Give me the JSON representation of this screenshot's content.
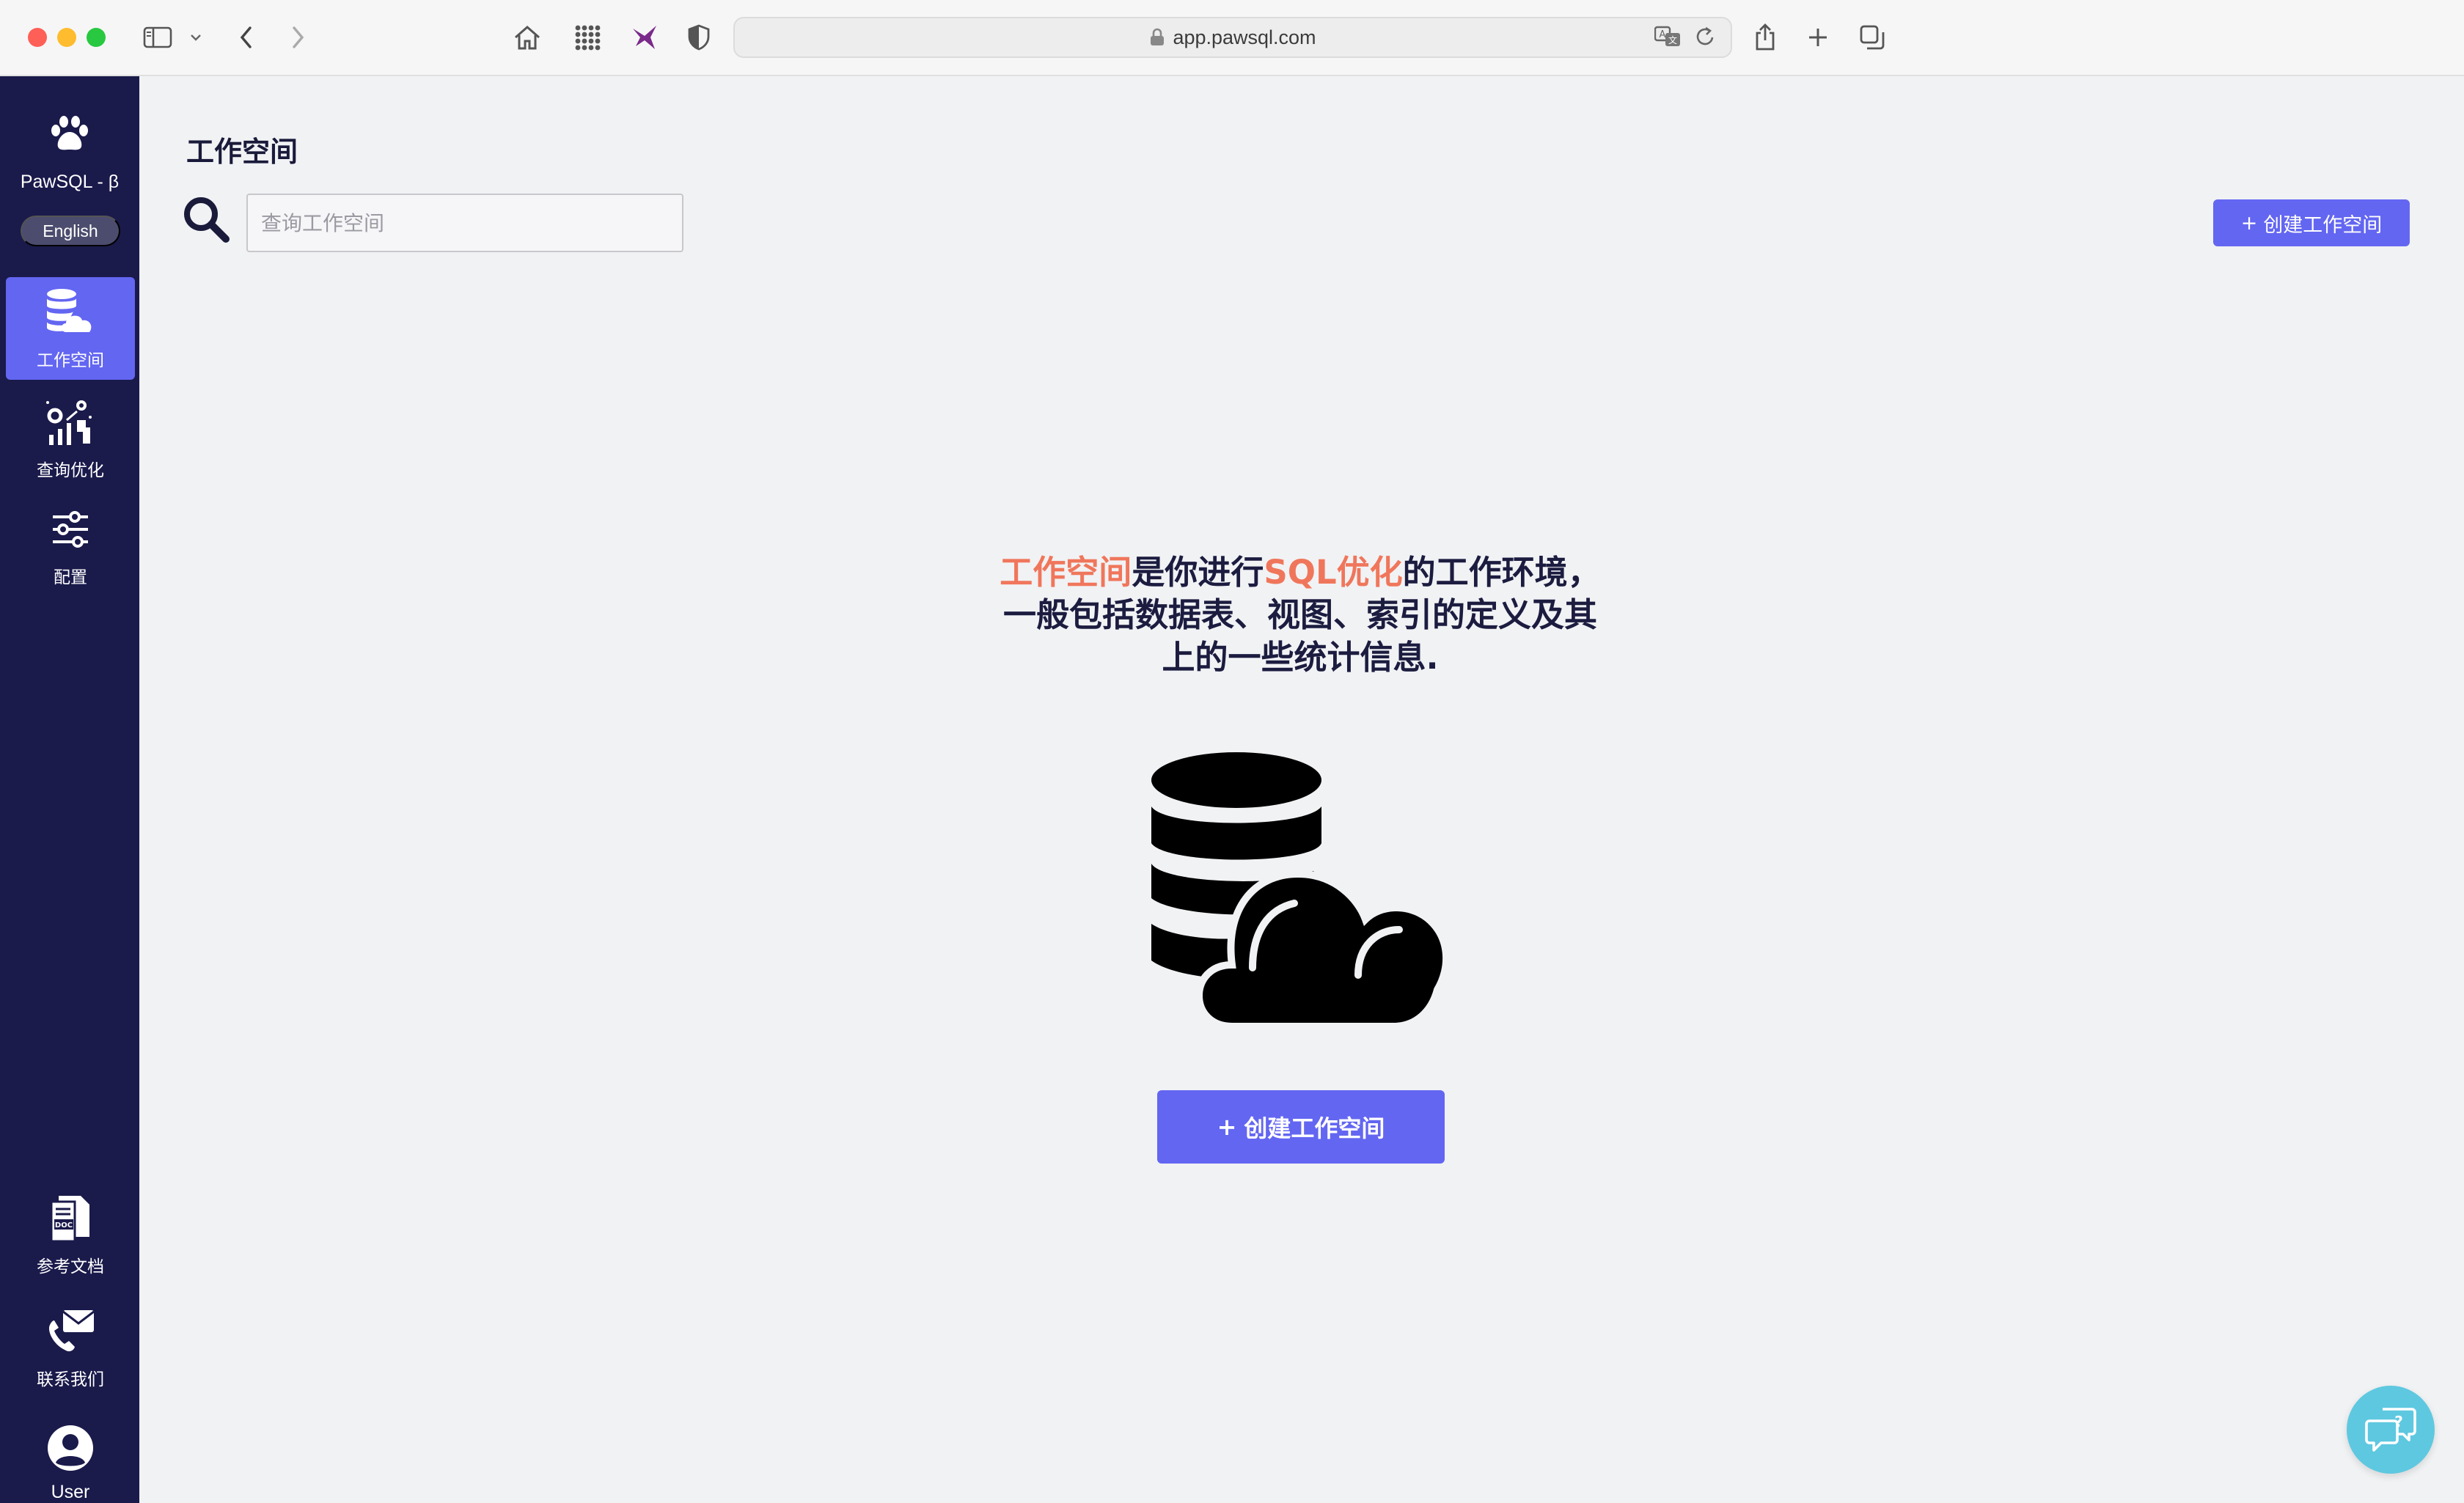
{
  "browser": {
    "url": "app.pawsql.com"
  },
  "sidebar": {
    "brand": "PawSQL - β",
    "language_toggle": "English",
    "items": [
      {
        "label": "工作空间",
        "icon": "database-cloud-icon",
        "active": true
      },
      {
        "label": "查询优化",
        "icon": "query-optimize-icon",
        "active": false
      },
      {
        "label": "配置",
        "icon": "sliders-icon",
        "active": false
      }
    ],
    "bottom_items": [
      {
        "label": "参考文档",
        "icon": "doc-icon"
      },
      {
        "label": "联系我们",
        "icon": "contact-icon"
      },
      {
        "label": "User",
        "icon": "user-avatar-icon"
      }
    ]
  },
  "main": {
    "title": "工作空间",
    "search": {
      "placeholder": "查询工作空间",
      "value": ""
    },
    "create_button_top": "创建工作空间",
    "create_button_plus": "+",
    "headline": {
      "part1": "工作空间",
      "part2": "是你进行",
      "part3": "SQL优化",
      "part4": "的工作环境，一般包括数据表、视图、索引的定义及其上的一些统计信息."
    },
    "create_button_main": "创建工作空间"
  },
  "colors": {
    "sidebar_bg": "#1a1a4b",
    "accent": "#6366f1",
    "highlight": "#f0765b",
    "fab": "#5ec8e0"
  }
}
